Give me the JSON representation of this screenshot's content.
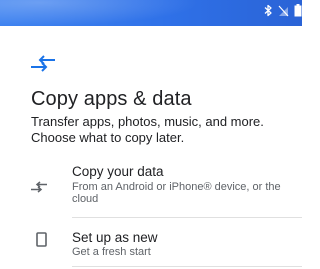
{
  "header": {
    "title": "Copy apps & data",
    "description": "Transfer apps, photos, music, and more. Choose what to copy later."
  },
  "options": [
    {
      "label": "Copy your data",
      "subtitle": "From an Android or iPhone® device, or the cloud",
      "icon": "transfer-arrows-icon"
    },
    {
      "label": "Set up as new",
      "subtitle": "Get a fresh start",
      "icon": "phone-icon"
    }
  ],
  "status_bar": {
    "icons": [
      "bluetooth-icon",
      "signal-off-icon",
      "battery-icon"
    ],
    "background": "#3f83f0"
  },
  "colors": {
    "accent": "#1a73e8",
    "text": "#202124",
    "secondary_text": "#5f6368"
  }
}
